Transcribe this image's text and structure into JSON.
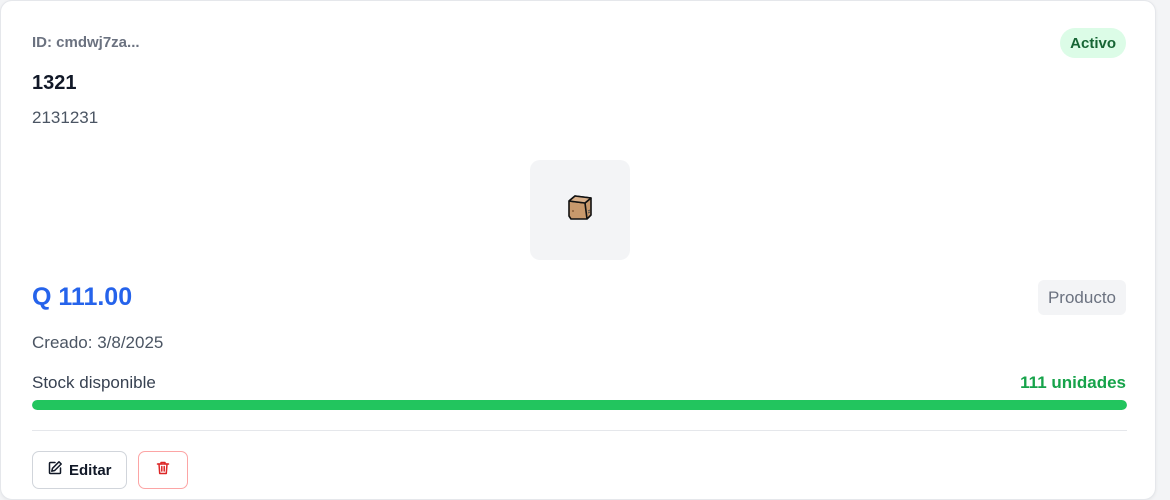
{
  "product": {
    "id_label": "ID: cmdwj7za...",
    "status": "Activo",
    "name": "1321",
    "description": "2131231",
    "image_icon": "package-icon",
    "price": "Q 111.00",
    "type": "Producto",
    "created": "Creado: 3/8/2025",
    "stock_label": "Stock disponible",
    "stock_units": "111 unidades",
    "stock_fraction": 1.0
  },
  "actions": {
    "edit_label": "Editar",
    "edit_icon": "pencil-icon",
    "delete_icon": "trash-icon"
  },
  "colors": {
    "price": "#2563eb",
    "stock": "#16a34a",
    "status_bg": "#dcfce7",
    "danger": "#dc2626"
  }
}
